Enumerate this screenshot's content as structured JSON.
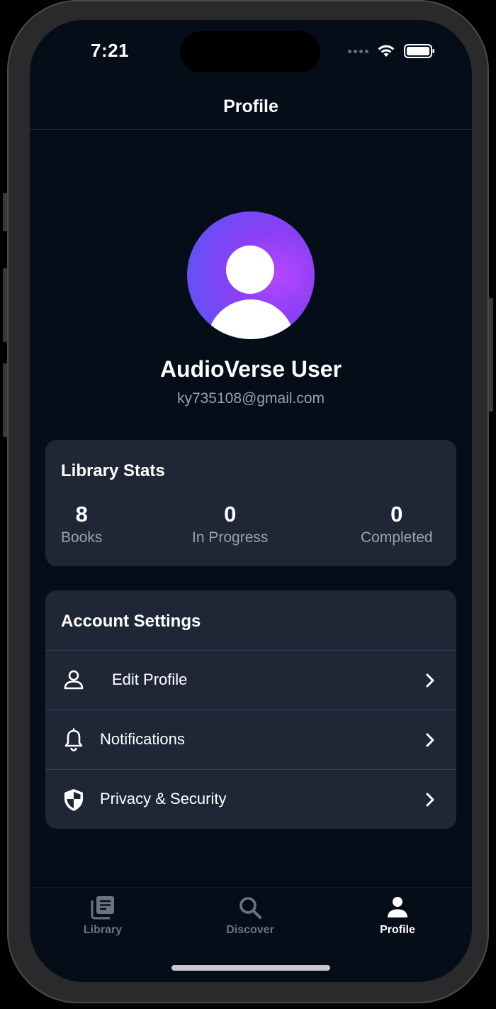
{
  "status_bar": {
    "time": "7:21"
  },
  "header": {
    "title": "Profile"
  },
  "user": {
    "name": "AudioVerse User",
    "email": "ky735108@gmail.com"
  },
  "library_stats": {
    "title": "Library Stats",
    "stats": [
      {
        "value": "8",
        "label": "Books"
      },
      {
        "value": "0",
        "label": "In Progress"
      },
      {
        "value": "0",
        "label": "Completed"
      }
    ]
  },
  "account_settings": {
    "title": "Account Settings",
    "items": [
      {
        "label": "Edit Profile",
        "icon": "person-outline-icon"
      },
      {
        "label": "Notifications",
        "icon": "bell-icon"
      },
      {
        "label": "Privacy & Security",
        "icon": "shield-icon"
      }
    ]
  },
  "tab_bar": {
    "tabs": [
      {
        "label": "Library",
        "icon": "library-icon",
        "active": false
      },
      {
        "label": "Discover",
        "icon": "search-icon",
        "active": false
      },
      {
        "label": "Profile",
        "icon": "person-icon",
        "active": true
      }
    ]
  },
  "colors": {
    "background": "#050d19",
    "card": "#1f2737",
    "secondary_text": "#9aa1ad",
    "tab_inactive": "#6b7280",
    "avatar_gradient_start": "#5a59f2",
    "avatar_gradient_end": "#b347ff"
  }
}
